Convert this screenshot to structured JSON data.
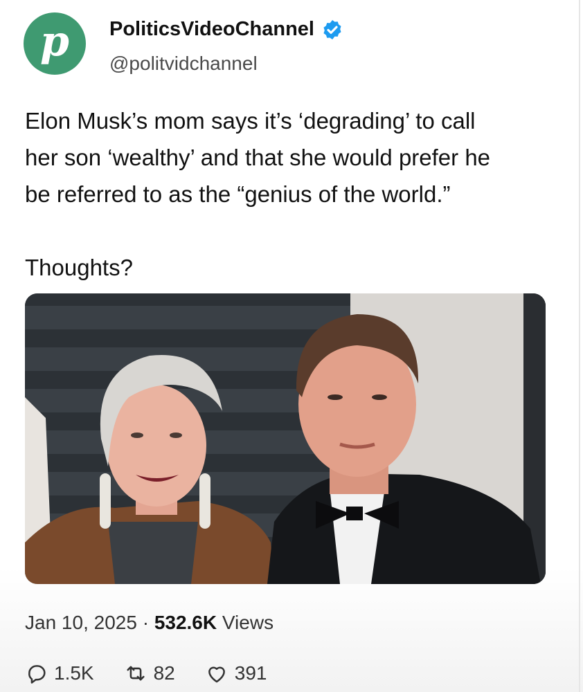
{
  "post": {
    "author": {
      "avatar_letter": "p",
      "avatar_color": "#3f9a71",
      "display_name": "PoliticsVideoChannel",
      "handle": "@politvidchannel",
      "verified_icon": "verified-badge-icon",
      "verified_color": "#1d9bf0"
    },
    "text": {
      "line1": "Elon Musk’s mom says it’s ‘degrading’ to call",
      "line2": "her son ‘wealthy’ and that she would prefer he",
      "line3": "be referred to as the “genius of the world.”",
      "question": "Thoughts?"
    },
    "media": {
      "type": "photo"
    },
    "meta": {
      "date": "Jan 10, 2025",
      "separator": "·",
      "views_count": "532.6K",
      "views_label": "Views"
    },
    "actions": {
      "replies": {
        "icon": "reply-icon",
        "count": "1.5K"
      },
      "reposts": {
        "icon": "repost-icon",
        "count": "82"
      },
      "likes": {
        "icon": "heart-icon",
        "count": "391"
      }
    }
  }
}
